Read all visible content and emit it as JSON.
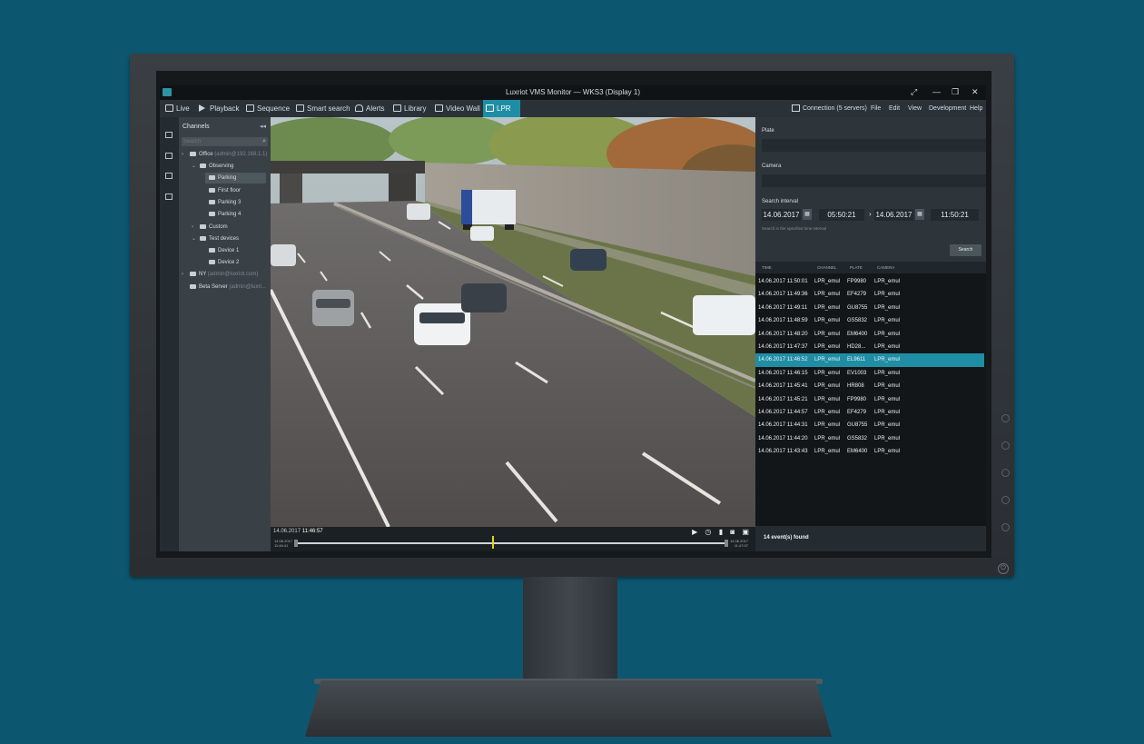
{
  "window": {
    "title": "Luxriot VMS Monitor — WKS3 (Display 1)",
    "controls": [
      "⤢",
      "—",
      "❐",
      "✕"
    ]
  },
  "tabs": [
    {
      "label": "Live",
      "icon": "monitor-icon"
    },
    {
      "label": "Playback",
      "icon": "play-icon"
    },
    {
      "label": "Sequence",
      "icon": "sequence-icon"
    },
    {
      "label": "Smart search",
      "icon": "smart-search-icon"
    },
    {
      "label": "Alerts",
      "icon": "bell-icon"
    },
    {
      "label": "Library",
      "icon": "library-icon"
    },
    {
      "label": "Video Wall",
      "icon": "video-wall-icon"
    },
    {
      "label": "LPR",
      "icon": "lpr-icon",
      "active": true
    }
  ],
  "right_menu": {
    "connection": "Connection (5 servers)",
    "file": "File",
    "edit": "Edit",
    "view": "View",
    "development": "Development",
    "help": "Help"
  },
  "channels": {
    "header": "Channels",
    "collapse": "◂◂",
    "search_placeholder": "Search",
    "tree": [
      {
        "label": "Office",
        "sub": "(admin@192.168.1.1)",
        "level": 0,
        "arrow": "›"
      },
      {
        "label": "Observing",
        "level": 1,
        "arrow": "⌄"
      },
      {
        "label": "Parking",
        "level": 2,
        "selected": true
      },
      {
        "label": "First floor",
        "level": 2
      },
      {
        "label": "Parking 3",
        "level": 2
      },
      {
        "label": "Parking 4",
        "level": 2
      },
      {
        "label": "Custom",
        "level": 1,
        "arrow": "›"
      },
      {
        "label": "Test devices",
        "level": 1,
        "arrow": "⌄"
      },
      {
        "label": "Device 1",
        "level": 2
      },
      {
        "label": "Device 2",
        "level": 2
      },
      {
        "label": "NY",
        "sub": "(admin@luxriot.com)",
        "level": 0,
        "arrow": "›"
      },
      {
        "label": "Beta Server",
        "sub": "(admin@luxri...",
        "level": 0
      }
    ]
  },
  "video": {
    "timestamp_date": "14.06.2017",
    "timestamp_time": "11:46:57",
    "controls": "▶ ◷ ▮ ◙ ▣",
    "tl_left_date": "14.06.2017",
    "tl_left_time": "11:46:41",
    "tl_right_date": "14.06.2017",
    "tl_right_time": "11:47:07",
    "position": 0.5
  },
  "lpr": {
    "plate_label": "Plate",
    "camera_label": "Camera",
    "interval_label": "Search interval",
    "from_date": "14.06.2017",
    "from_time": "05:50:21",
    "to_date": "14.06.2017",
    "to_time": "11:50:21",
    "arrow": "›",
    "hint": "Search in the specified time interval",
    "search_button": "Search",
    "columns": [
      "TIME",
      "CHANNEL",
      "PLATE",
      "CAMERA"
    ],
    "rows": [
      {
        "time": "14.06.2017 11:50:01",
        "channel": "LPR_emul",
        "plate": "FP9980",
        "camera": "LPR_emul"
      },
      {
        "time": "14.06.2017 11:49:36",
        "channel": "LPR_emul",
        "plate": "EF4279",
        "camera": "LPR_emul"
      },
      {
        "time": "14.06.2017 11:49:11",
        "channel": "LPR_emul",
        "plate": "GU8755",
        "camera": "LPR_emul"
      },
      {
        "time": "14.06.2017 11:48:59",
        "channel": "LPR_emul",
        "plate": "GS5832",
        "camera": "LPR_emul"
      },
      {
        "time": "14.06.2017 11:48:20",
        "channel": "LPR_emul",
        "plate": "EM6400",
        "camera": "LPR_emul"
      },
      {
        "time": "14.06.2017 11:47:37",
        "channel": "LPR_emul",
        "plate": "HD28...",
        "camera": "LPR_emul"
      },
      {
        "time": "14.06.2017 11:46:52",
        "channel": "LPR_emul",
        "plate": "EL9611",
        "camera": "LPR_emul",
        "selected": true
      },
      {
        "time": "14.06.2017 11:46:15",
        "channel": "LPR_emul",
        "plate": "EV1003",
        "camera": "LPR_emul"
      },
      {
        "time": "14.06.2017 11:45:41",
        "channel": "LPR_emul",
        "plate": "HR808",
        "camera": "LPR_emul"
      },
      {
        "time": "14.06.2017 11:45:21",
        "channel": "LPR_emul",
        "plate": "FP9980",
        "camera": "LPR_emul"
      },
      {
        "time": "14.06.2017 11:44:57",
        "channel": "LPR_emul",
        "plate": "EF4279",
        "camera": "LPR_emul"
      },
      {
        "time": "14.06.2017 11:44:31",
        "channel": "LPR_emul",
        "plate": "GU8755",
        "camera": "LPR_emul"
      },
      {
        "time": "14.06.2017 11:44:20",
        "channel": "LPR_emul",
        "plate": "GS5832",
        "camera": "LPR_emul"
      },
      {
        "time": "14.06.2017 11:43:43",
        "channel": "LPR_emul",
        "plate": "EM6400",
        "camera": "LPR_emul"
      }
    ],
    "found_text": "14 event(s) found"
  },
  "colors": {
    "accent": "#1f8ea5",
    "background": "#0d5670",
    "timeline_marker": "#e8d21c"
  }
}
